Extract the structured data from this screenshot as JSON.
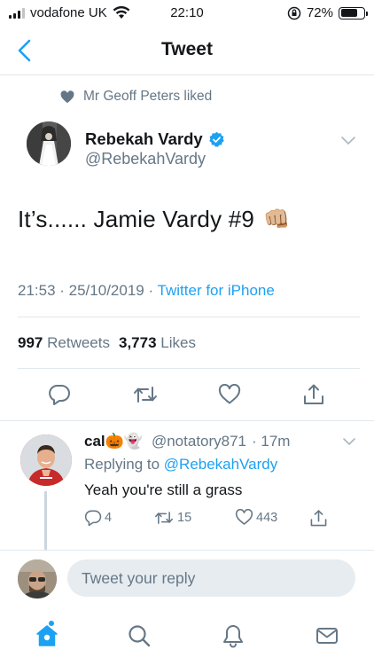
{
  "status_bar": {
    "carrier": "vodafone UK",
    "time": "22:10",
    "battery_text": "72%",
    "battery_level": 0.72
  },
  "header": {
    "title": "Tweet"
  },
  "social_context": {
    "text": "Mr Geoff Peters liked"
  },
  "tweet": {
    "author_name": "Rebekah Vardy",
    "author_handle": "@RebekahVardy",
    "verified": true,
    "text": "It’s...... Jamie Vardy #9",
    "emoji": "👊🏼",
    "timestamp": "21:53 · 25/10/2019 · ",
    "source": "Twitter for iPhone",
    "retweets_count": "997",
    "retweets_label": "Retweets",
    "likes_count": "3,773",
    "likes_label": "Likes"
  },
  "reply": {
    "name": "cal🎃👻",
    "handle": "@notatory871",
    "time": "· 17m",
    "replying_prefix": "Replying to ",
    "replying_to": "@RebekahVardy",
    "text": "Yeah you're still a grass",
    "reply_count": "4",
    "retweet_count": "15",
    "like_count": "443"
  },
  "compose": {
    "placeholder": "Tweet your reply"
  },
  "colors": {
    "accent": "#1da1f2",
    "secondary_text": "#657786",
    "divider": "#e1e8ed",
    "verified": "#1da1f2"
  },
  "tabs": [
    "home-icon",
    "search-icon",
    "notifications-icon",
    "messages-icon"
  ]
}
